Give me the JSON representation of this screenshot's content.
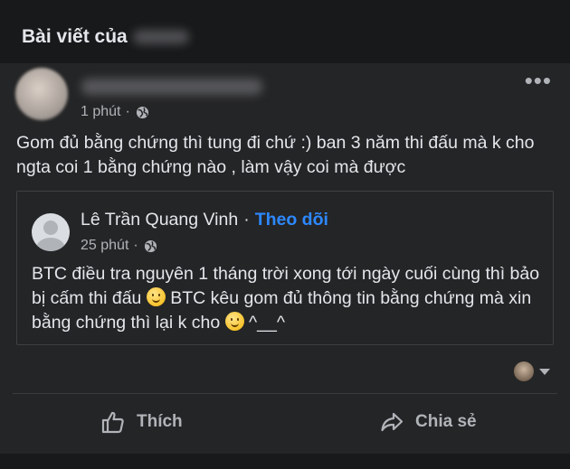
{
  "section": {
    "title": "Bài viết của"
  },
  "post": {
    "time": "1 phút",
    "more_label": "•••",
    "text": "Gom đủ bằng chứng thì tung đi chứ :) ban 3 năm thi đấu mà k cho ngta coi 1 bằng chứng nào , làm vậy coi mà được"
  },
  "shared_post": {
    "author": "Lê Trần Quang Vinh",
    "separator": "·",
    "follow_label": "Theo dõi",
    "time": "25 phút",
    "text_part1": "BTC điều tra nguyên 1 tháng trời xong tới ngày cuối cùng thì bảo bị cấm thi đấu",
    "text_part2": "BTC kêu gom đủ thông tin bằng chứng mà xin bằng chứng thì lại k cho",
    "text_part3": "^__^"
  },
  "actions": {
    "like_label": "Thích",
    "share_label": "Chia sẻ"
  },
  "colors": {
    "background": "#18191a",
    "card": "#242526",
    "accent": "#2d88ff",
    "secondary_text": "#b0b3b8"
  },
  "icons": [
    "globe-icon",
    "more-icon",
    "like-icon",
    "share-icon",
    "smile-emoji-icon",
    "dropdown-caret-icon"
  ]
}
